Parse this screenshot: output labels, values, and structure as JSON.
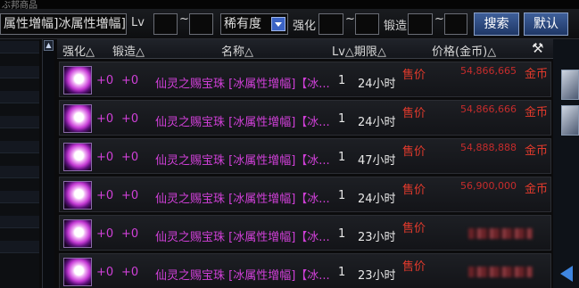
{
  "breadcrumb": "ぶ邦商品",
  "search": {
    "keyword": "属性増幅]冰属性増幅]",
    "lv_label": "Lv",
    "lv_sep": "~",
    "rarity_value": "稀有度",
    "enhance_label": "强化",
    "enhance_sep": "~",
    "forge_label": "锻造",
    "forge_sep": "~",
    "search_button": "搜索",
    "default_button": "默认"
  },
  "table": {
    "headers": {
      "enhance": "强化△",
      "forge": "锻造△",
      "name": "名称△",
      "lv_period": "Lv△期限△",
      "price": "价格(金币)△"
    },
    "price_label": "售价",
    "currency": "金币",
    "rows": [
      {
        "enhance": "+0",
        "forge": "+0",
        "name": "仙灵之赐宝珠 [冰属性增幅]【冰...",
        "lv": "1",
        "period": "24小时",
        "price": "54,866,665"
      },
      {
        "enhance": "+0",
        "forge": "+0",
        "name": "仙灵之赐宝珠 [冰属性增幅]【冰...",
        "lv": "1",
        "period": "24小时",
        "price": "54,866,666"
      },
      {
        "enhance": "+0",
        "forge": "+0",
        "name": "仙灵之赐宝珠 [冰属性增幅]【冰...",
        "lv": "1",
        "period": "47小时",
        "price": "54,888,888"
      },
      {
        "enhance": "+0",
        "forge": "+0",
        "name": "仙灵之赐宝珠 [冰属性增幅]【冰...",
        "lv": "1",
        "period": "24小时",
        "price": "56,900,000"
      },
      {
        "enhance": "+0",
        "forge": "+0",
        "name": "仙灵之赐宝珠 [冰属性增幅]【冰...",
        "lv": "1",
        "period": "23小时",
        "price": null
      },
      {
        "enhance": "+0",
        "forge": "+0",
        "name": "仙灵之赐宝珠 [冰属性增幅]【冰...",
        "lv": "1",
        "period": "23小时",
        "price": null
      }
    ]
  }
}
